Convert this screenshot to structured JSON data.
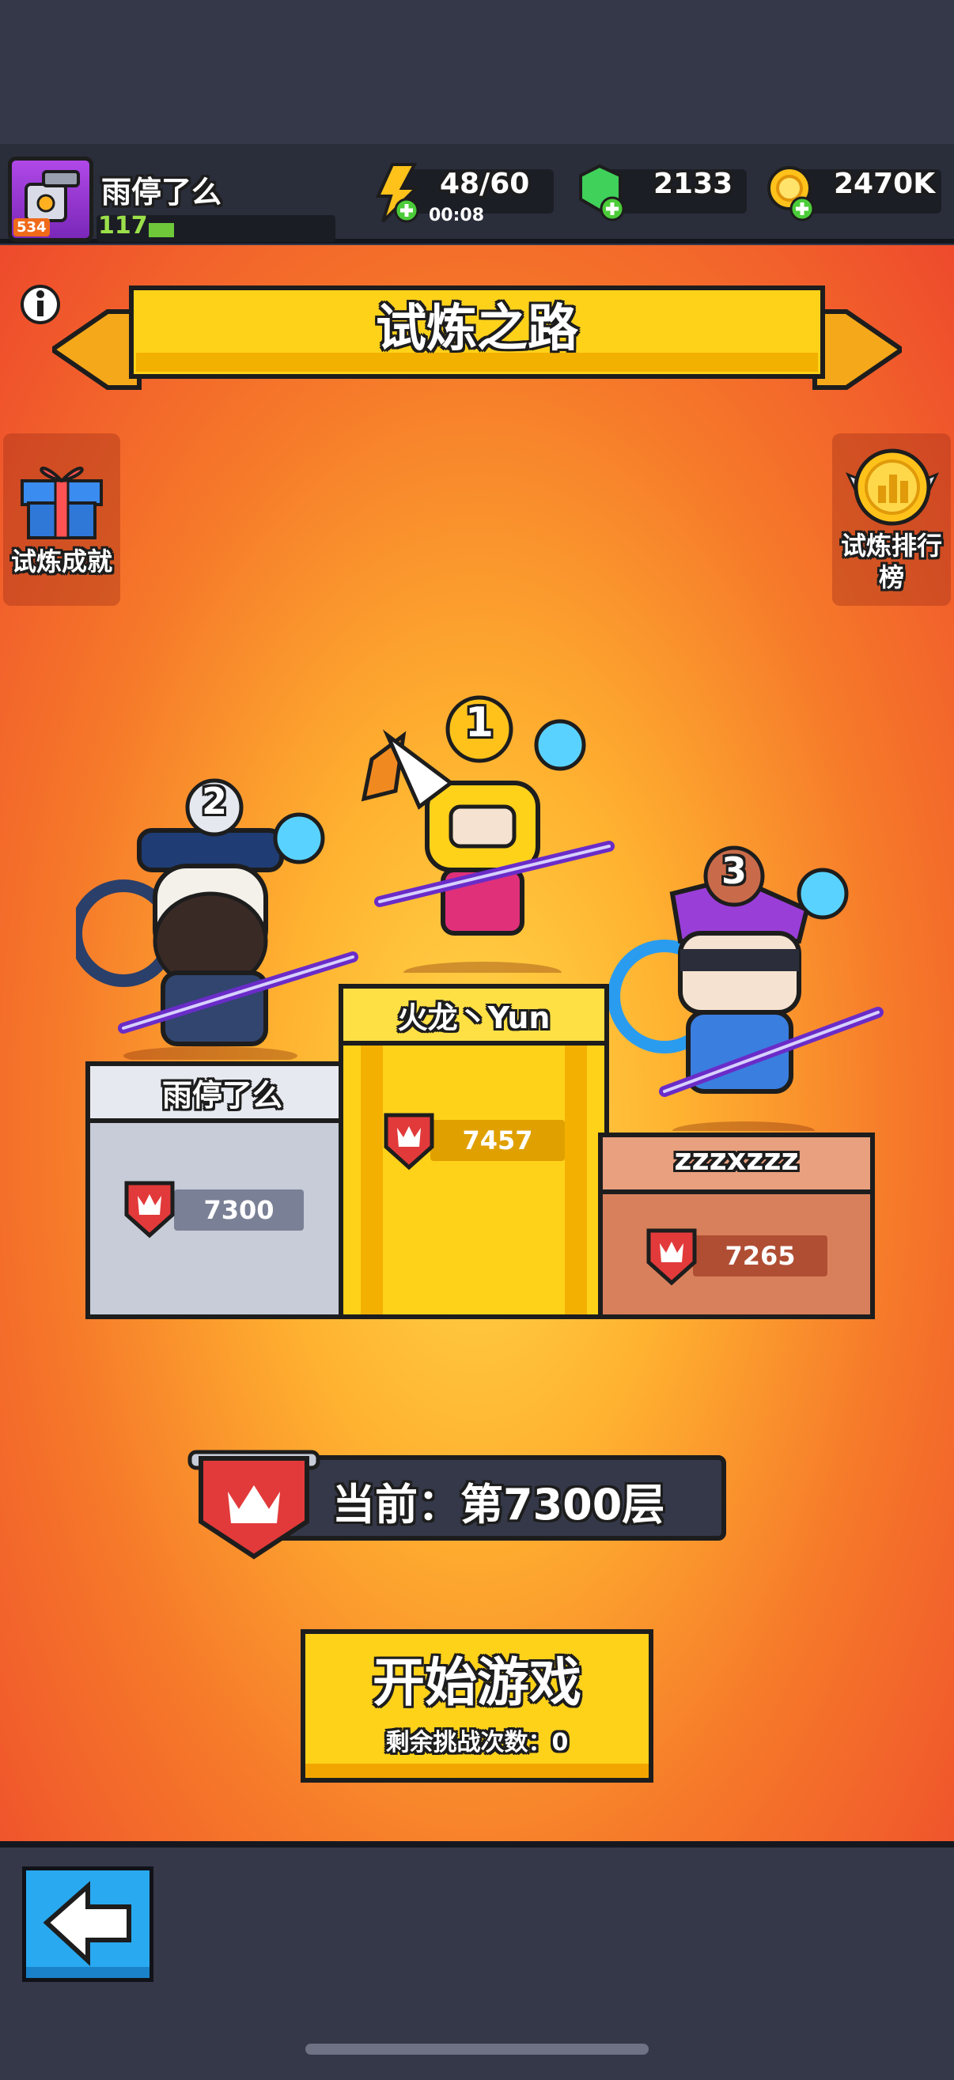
{
  "player": {
    "name": "雨停了么",
    "level": "117",
    "avatar_level": "534"
  },
  "resources": {
    "energy": {
      "value": "48/60",
      "timer": "00:08",
      "icon": "lightning-icon"
    },
    "gems": {
      "value": "2133",
      "icon": "green-gem-icon"
    },
    "coins": {
      "value": "2470K",
      "icon": "gold-coin-icon"
    }
  },
  "title": "试炼之路",
  "side_buttons": {
    "achievements": "试炼成就",
    "leaderboard_line1": "试炼排行",
    "leaderboard_line2": "榜"
  },
  "podium": [
    {
      "rank": "1",
      "name": "火龙丶Yun",
      "score": "7457"
    },
    {
      "rank": "2",
      "name": "雨停了么",
      "score": "7300"
    },
    {
      "rank": "3",
      "name": "zzzxzzz",
      "score": "7265"
    }
  ],
  "current_floor": "当前：第7300层",
  "start_button": {
    "label": "开始游戏",
    "remaining": "剩余挑战次数：0"
  },
  "colors": {
    "gold": "#ffd21a",
    "silver": "#c7ccd8",
    "bronze": "#d8805c",
    "shield_red": "#e23a3a"
  }
}
